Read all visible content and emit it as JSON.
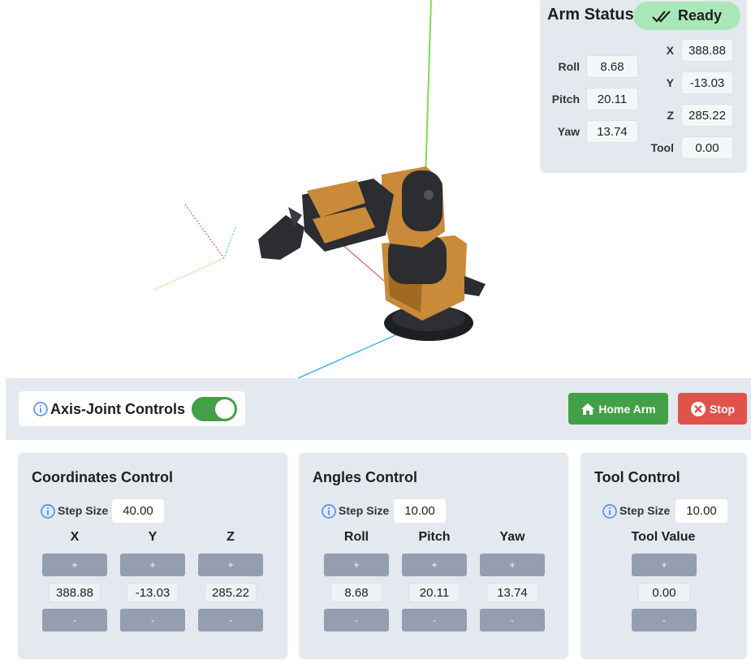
{
  "status": {
    "title": "Arm Status",
    "badge": "Ready",
    "roll_label": "Roll",
    "roll": "8.68",
    "pitch_label": "Pitch",
    "pitch": "20.11",
    "yaw_label": "Yaw",
    "yaw": "13.74",
    "x_label": "X",
    "x": "388.88",
    "y_label": "Y",
    "y": "-13.03",
    "z_label": "Z",
    "z": "285.22",
    "tool_label": "Tool",
    "tool": "0.00"
  },
  "bar": {
    "toggle_label": "Axis-Joint Controls",
    "toggle_on": true,
    "home_label": "Home Arm",
    "stop_label": "Stop"
  },
  "coords": {
    "title": "Coordinates Control",
    "step_label": "Step Size",
    "step": "40.00",
    "columns": [
      {
        "head": "X",
        "value": "388.88"
      },
      {
        "head": "Y",
        "value": "-13.03"
      },
      {
        "head": "Z",
        "value": "285.22"
      }
    ]
  },
  "angles": {
    "title": "Angles Control",
    "step_label": "Step Size",
    "step": "10.00",
    "columns": [
      {
        "head": "Roll",
        "value": "8.68"
      },
      {
        "head": "Pitch",
        "value": "20.11"
      },
      {
        "head": "Yaw",
        "value": "13.74"
      }
    ]
  },
  "tool": {
    "title": "Tool Control",
    "step_label": "Step Size",
    "step": "10.00",
    "columns": [
      {
        "head": "Tool Value",
        "value": "0.00"
      }
    ]
  },
  "buttons": {
    "plus": "+",
    "minus": "-"
  },
  "colors": {
    "green": "#43a047",
    "red": "#e0534a",
    "ready": "#a9e7b8",
    "panel": "#e4e8ef",
    "button": "#949eb0"
  }
}
